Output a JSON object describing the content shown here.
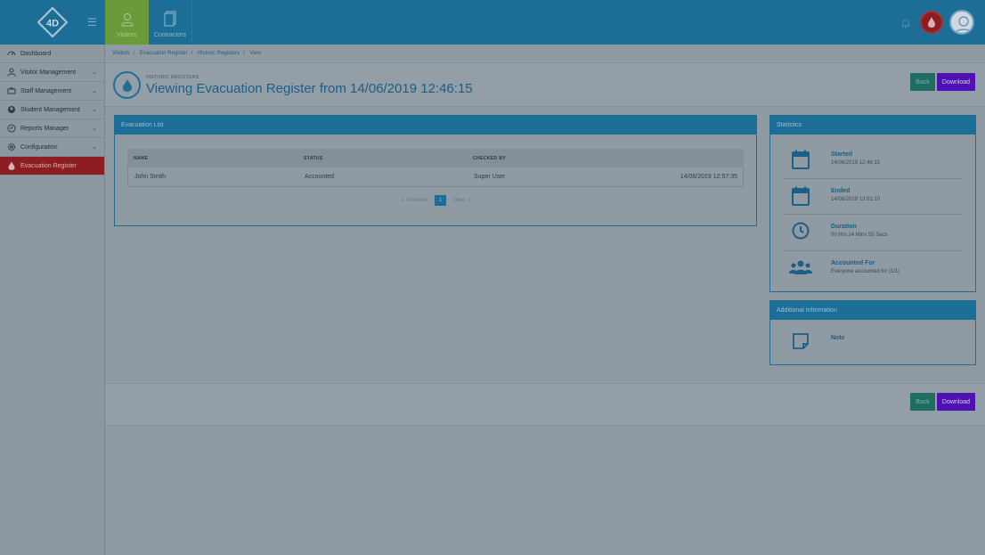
{
  "topnav": {
    "visitors_label": "Visitors",
    "contractors_label": "Contractors"
  },
  "sidebar": {
    "items": [
      {
        "label": "Dashboard"
      },
      {
        "label": "Visitor Management"
      },
      {
        "label": "Staff Management"
      },
      {
        "label": "Student Management"
      },
      {
        "label": "Reports Manager"
      },
      {
        "label": "Configuration"
      },
      {
        "label": "Evacuation Register"
      }
    ]
  },
  "breadcrumb": [
    "Visitors",
    "Evacuation Register",
    "Historic Registers",
    "View"
  ],
  "header": {
    "kicker": "HISTORIC REGISTERS",
    "title": "Viewing Evacuation Register from 14/06/2019 12:46:15",
    "back_label": "Back",
    "download_label": "Download"
  },
  "evacuation_list": {
    "title": "Evacuation List",
    "columns": [
      "NAME",
      "STATUS",
      "CHECKED BY",
      ""
    ],
    "rows": [
      {
        "name": "John Smith",
        "status": "Accounted",
        "checked_by": "Super User",
        "time": "14/06/2019 12:57:35"
      }
    ],
    "pager": {
      "previous": "Previous",
      "page": "1",
      "next": "Next"
    }
  },
  "statistics": {
    "title": "Statistics",
    "items": [
      {
        "label": "Started",
        "value": "14/06/2019 12:46:15"
      },
      {
        "label": "Ended",
        "value": "14/06/2019 13:01:10"
      },
      {
        "label": "Duration",
        "value": "00 Hrs 14 Mins 55 Secs"
      },
      {
        "label": "Accounted For",
        "value": "Everyone accounted for (1/1)"
      }
    ]
  },
  "additional": {
    "title": "Additional Information",
    "note_label": "Note"
  },
  "footer": {
    "back_label": "Back",
    "download_label": "Download"
  },
  "colors": {
    "primary": "#1c6e96",
    "danger": "#8c1d22",
    "back": "#1f6d62",
    "download": "#4f11b3"
  }
}
